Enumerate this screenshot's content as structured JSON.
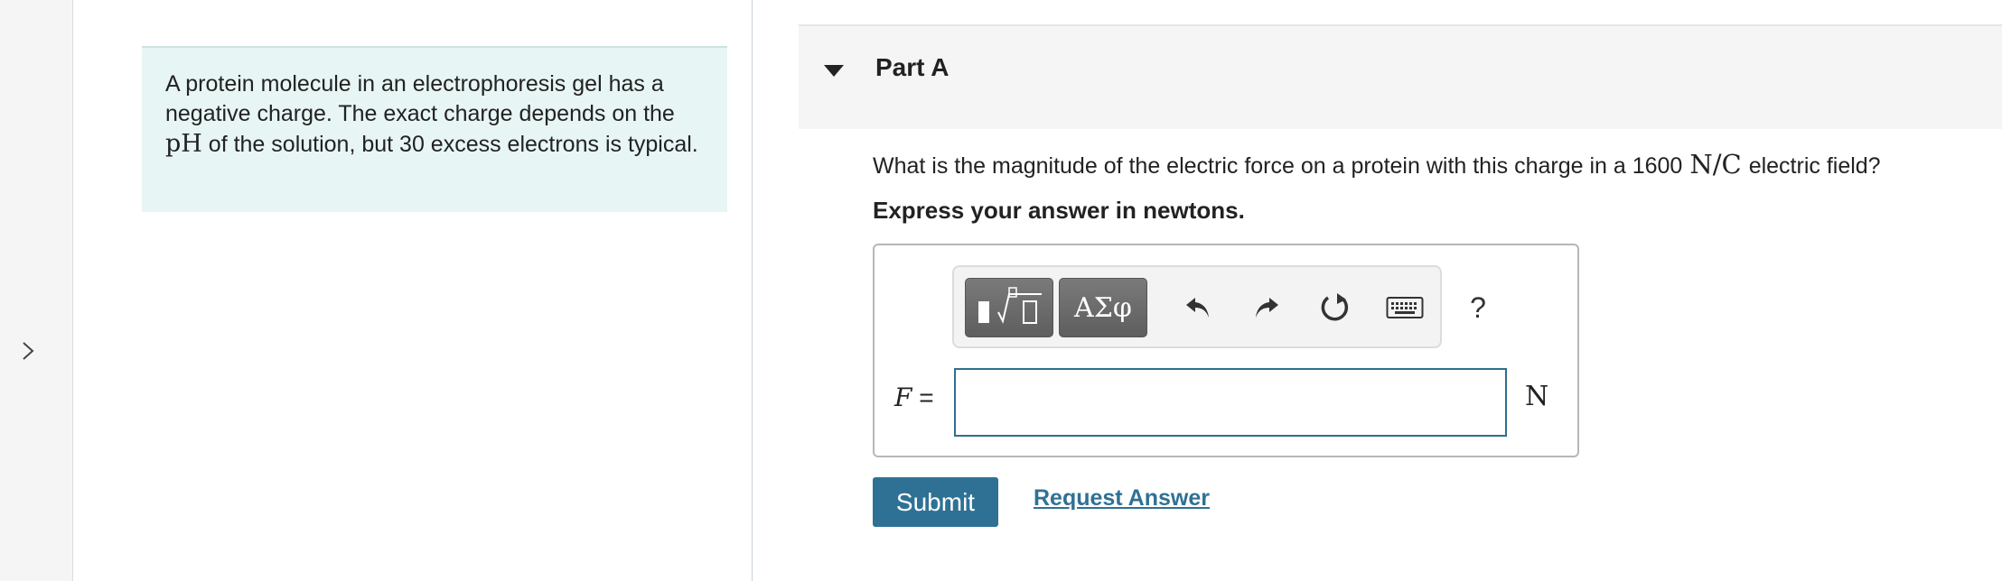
{
  "intro": {
    "text_before": "A protein molecule in an electrophoresis gel has a negative charge. The exact charge depends on the ",
    "ph_symbol": "pH",
    "text_after": " of the solution, but 30 excess electrons is typical."
  },
  "part": {
    "title": "Part A"
  },
  "question": {
    "text_before": "What is the magnitude of the electric force on a protein with this charge in a 1600",
    "unit": "N/C",
    "text_after": "electric field?",
    "instruction": "Express your answer in newtons."
  },
  "toolbar": {
    "greek_label": "ΑΣφ",
    "help_label": "?"
  },
  "answer": {
    "variable": "F",
    "equals": " =",
    "value": "",
    "unit": "N"
  },
  "actions": {
    "submit_label": "Submit",
    "request_label": "Request Answer"
  },
  "icons": {
    "expand": "chevron-right-icon",
    "collapse": "caret-down-icon",
    "templates": "templates-icon",
    "undo": "undo-icon",
    "redo": "redo-icon",
    "reset": "reset-icon",
    "keyboard": "keyboard-icon"
  },
  "colors": {
    "accent": "#2f7194",
    "intro_bg": "#e8f5f5"
  }
}
